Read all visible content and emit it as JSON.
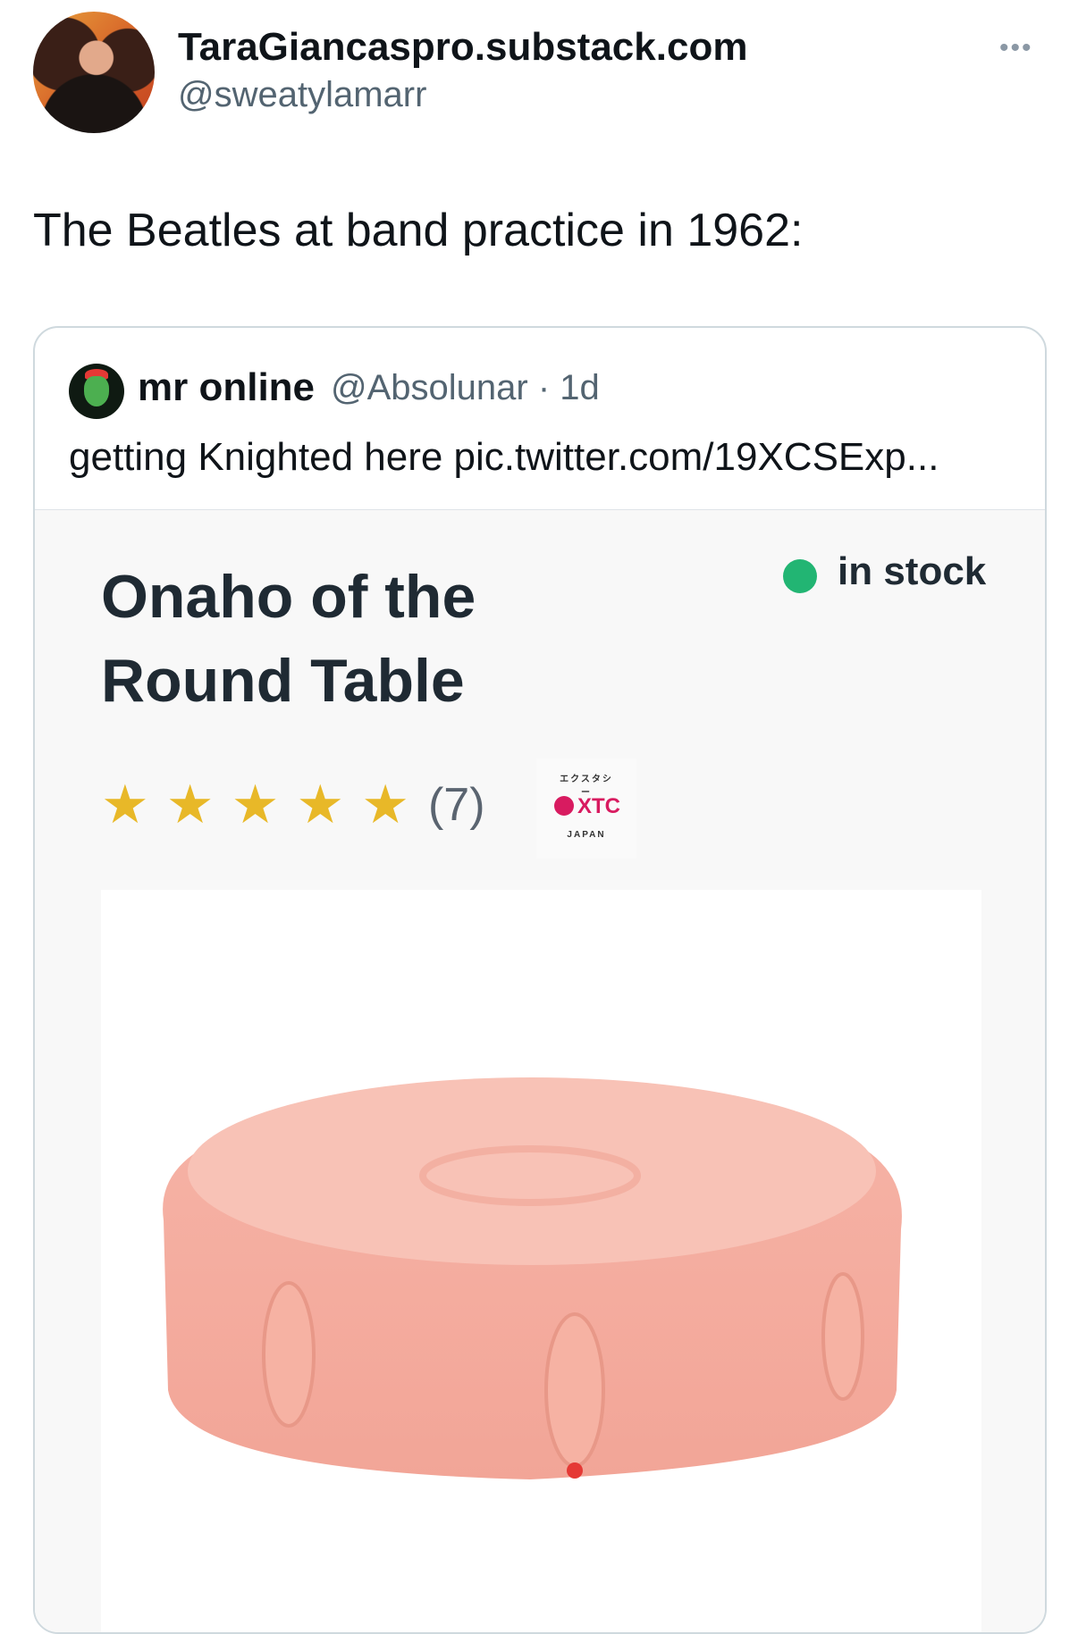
{
  "tweet": {
    "display_name": "TaraGiancaspro.substack.com",
    "handle": "@sweatylamarr",
    "more_icon": "more-horizontal-icon",
    "more_glyph": "•••",
    "text": "The Beatles at band practice in 1962:"
  },
  "quote": {
    "name": "mr online",
    "meta": "@Absolunar · 1d",
    "text": "getting Knighted here pic.twitter.com/19XCSExp...",
    "media": {
      "title": "Onaho of the Round Table",
      "stock_label": "in stock",
      "stock_color": "#22b573",
      "rating": 5,
      "rating_max": 5,
      "review_count": "(7)",
      "logo": {
        "brand": "XTC",
        "arc_top": "エクスタシー",
        "arc_bottom": "JAPAN"
      }
    }
  }
}
